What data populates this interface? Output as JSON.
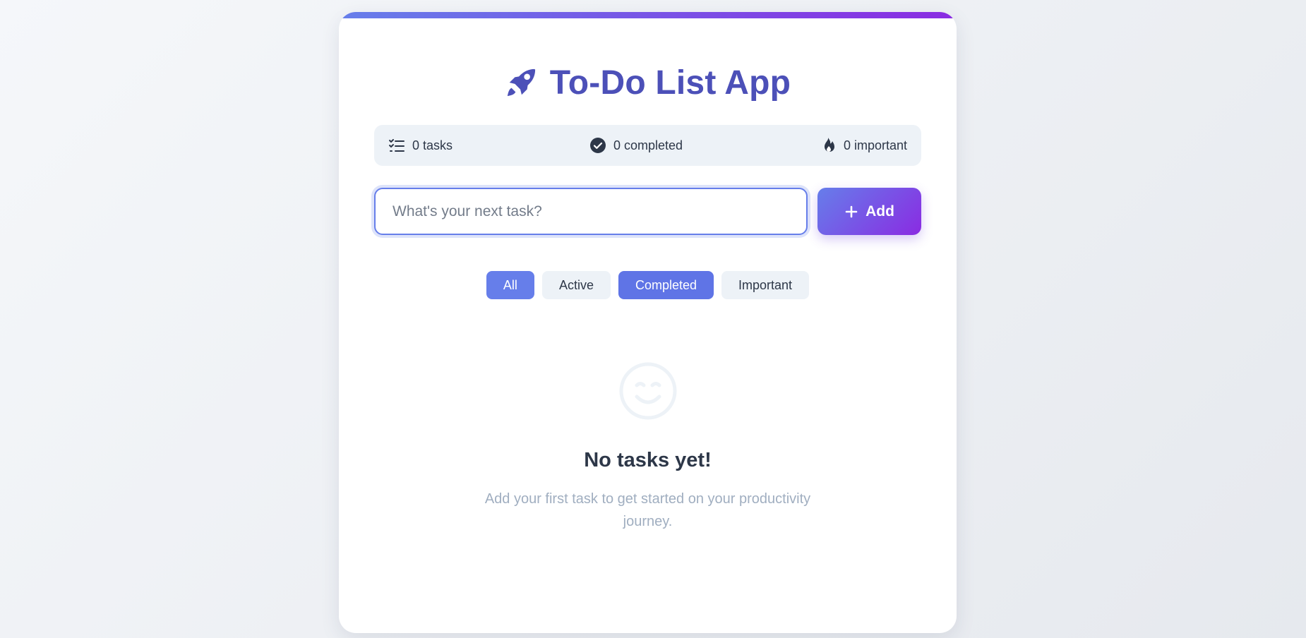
{
  "app": {
    "title": "To-Do List App",
    "icon": "rocket-icon"
  },
  "stats": {
    "tasks": {
      "label": "0 tasks",
      "icon": "task-list-icon"
    },
    "completed": {
      "label": "0 completed",
      "icon": "check-circle-icon"
    },
    "important": {
      "label": "0 important",
      "icon": "fire-icon"
    }
  },
  "input": {
    "placeholder": "What's your next task?",
    "value": ""
  },
  "add_button": {
    "label": "Add",
    "icon": "plus-icon"
  },
  "filters": [
    {
      "label": "All",
      "active": true
    },
    {
      "label": "Active",
      "active": false
    },
    {
      "label": "Completed",
      "active": true
    },
    {
      "label": "Important",
      "active": false
    }
  ],
  "empty_state": {
    "icon": "smile-icon",
    "title": "No tasks yet!",
    "text": "Add your first task to get started on your productivity journey."
  },
  "colors": {
    "accent": "#667eea",
    "accent_end": "#8a2be2",
    "title": "#4c50b8",
    "text": "#2d3748",
    "muted": "#a0aec0",
    "stat_bg": "#edf2f7"
  }
}
